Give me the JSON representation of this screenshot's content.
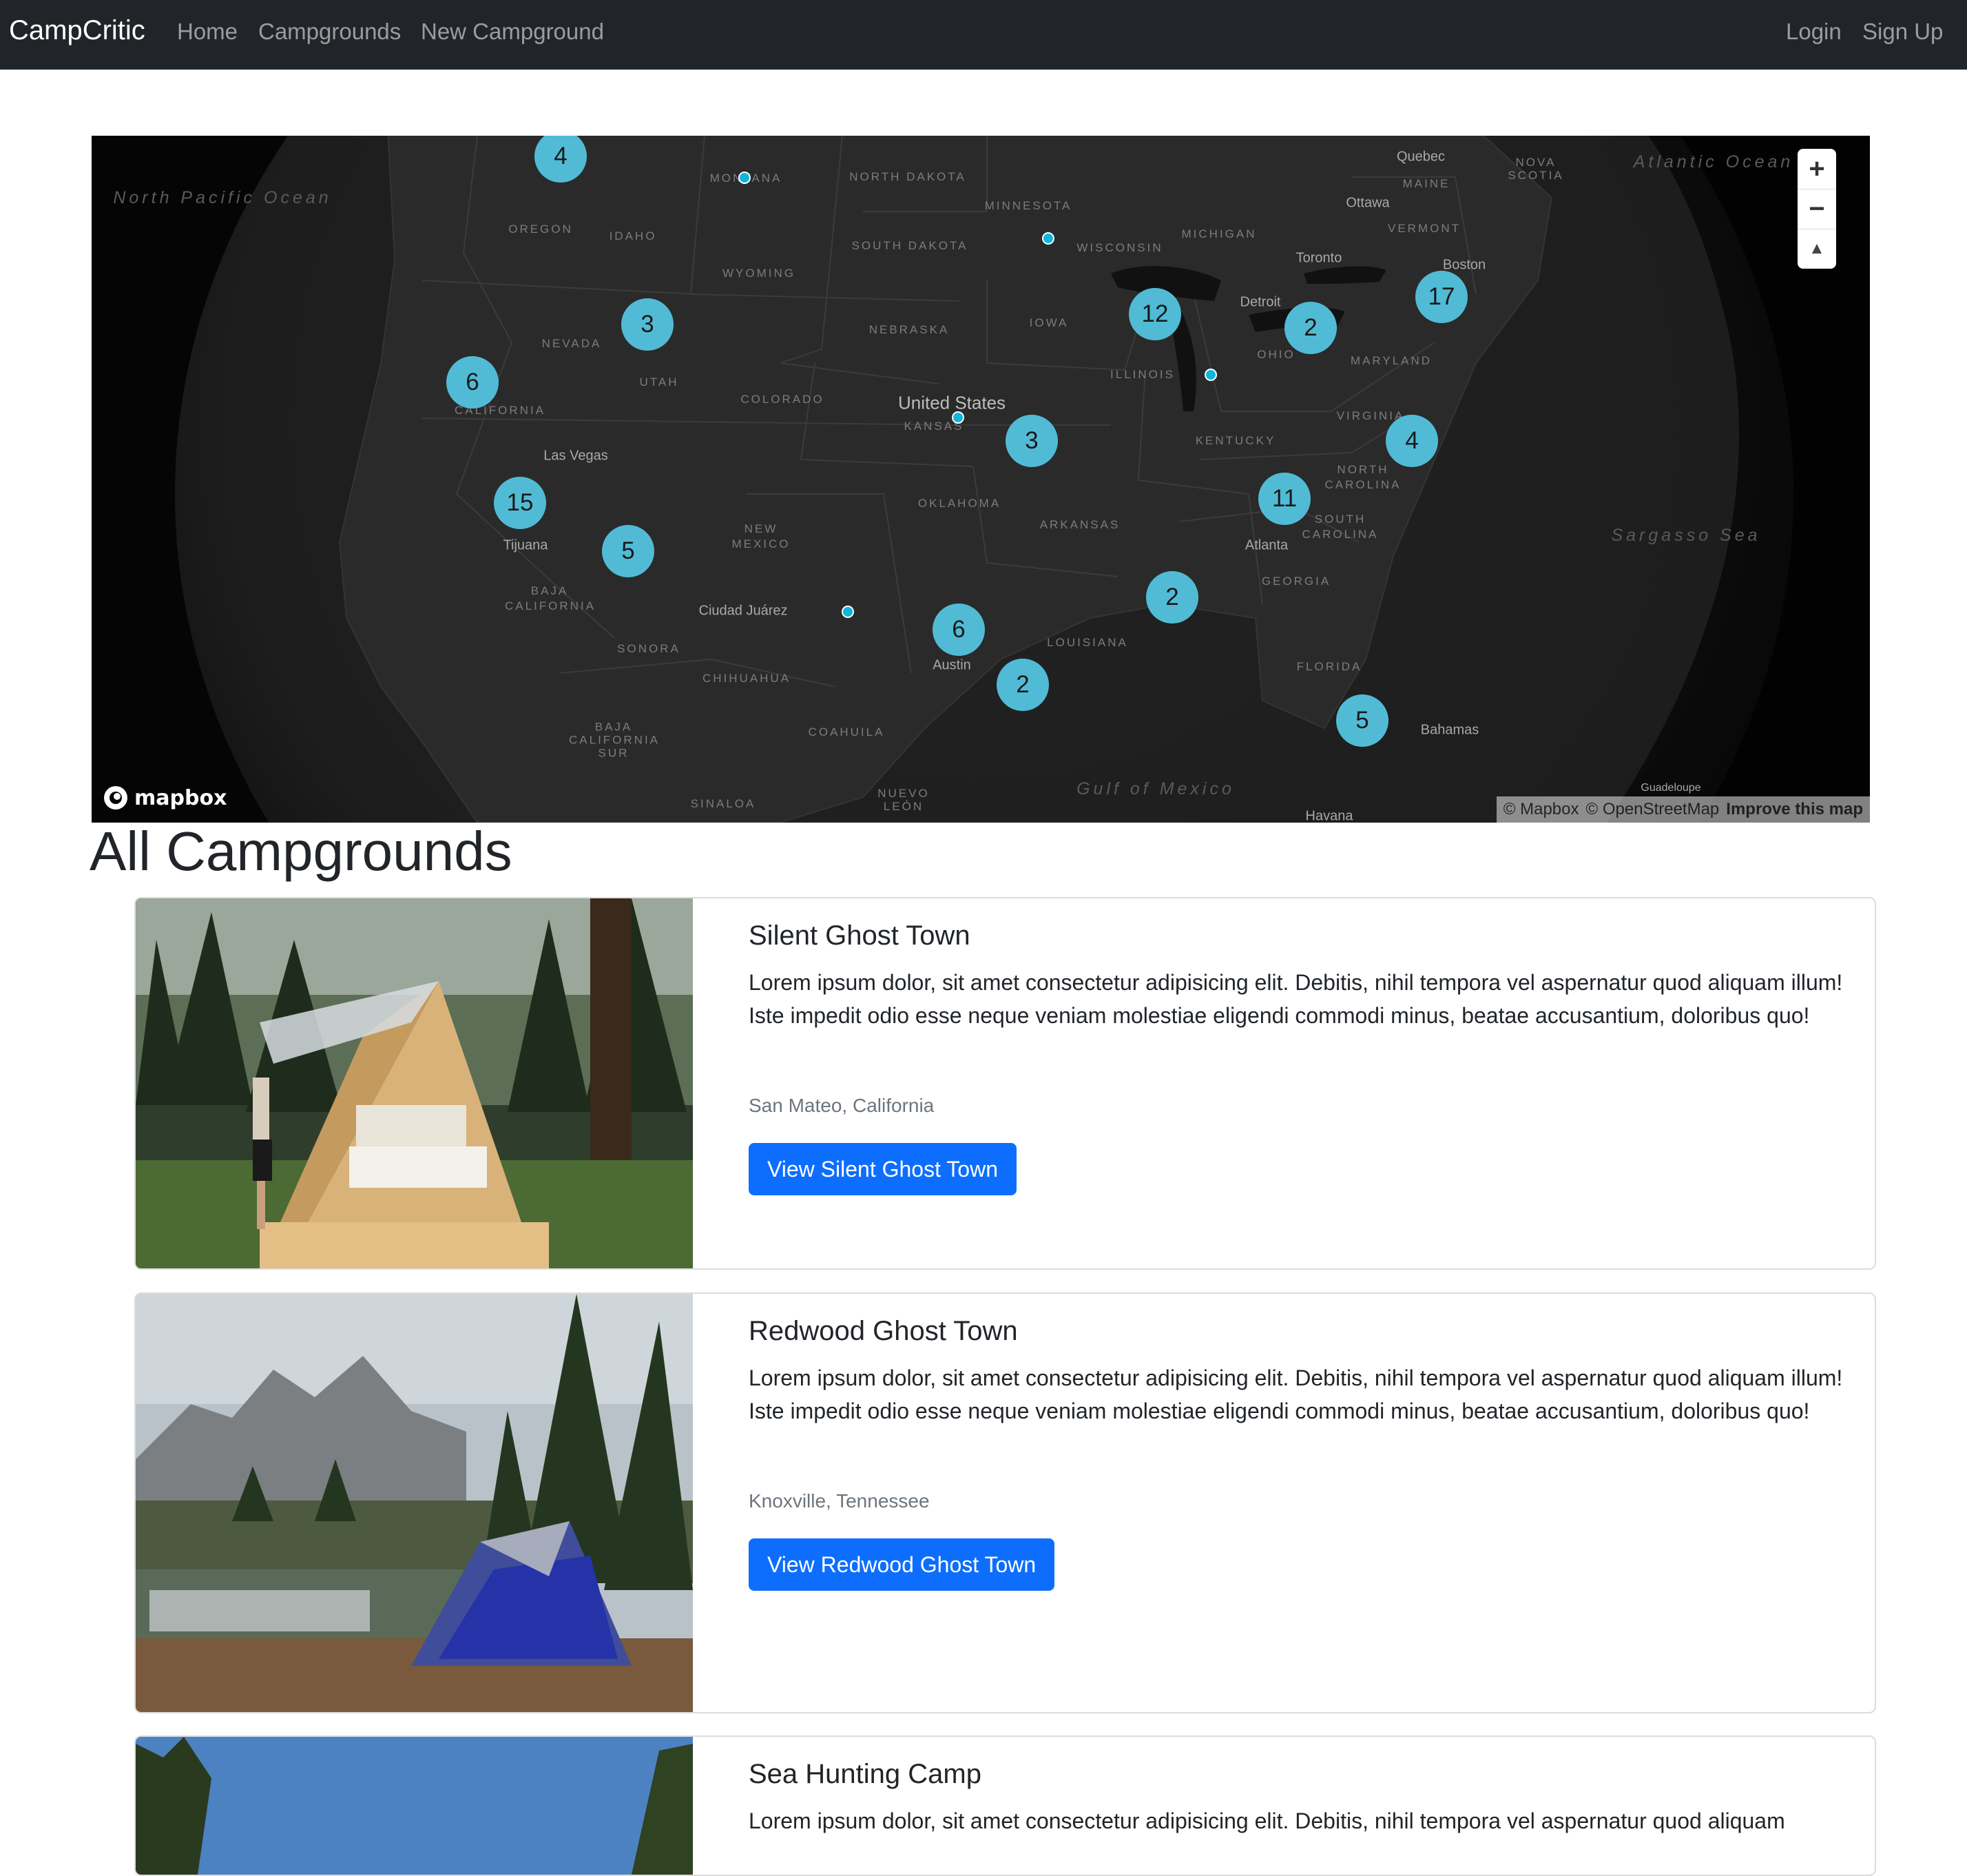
{
  "navbar": {
    "brand": "CampCritic",
    "links": [
      "Home",
      "Campgrounds",
      "New Campground"
    ],
    "auth": [
      "Login",
      "Sign Up"
    ]
  },
  "map": {
    "state_labels": [
      "MONTANA",
      "NORTH DAKOTA",
      "MINNESOTA",
      "OREGON",
      "IDAHO",
      "SOUTH DAKOTA",
      "WISCONSIN",
      "MICHIGAN",
      "WYOMING",
      "NEBRASKA",
      "IOWA",
      "NEVADA",
      "UTAH",
      "COLORADO",
      "ILLINOIS",
      "OHIO",
      "MARYLAND",
      "CALIFORNIA",
      "KANSAS",
      "VIRGINIA",
      "KENTUCKY",
      "NORTH CAROLINA",
      "OKLAHOMA",
      "ARKANSAS",
      "SOUTH CAROLINA",
      "NEW MEXICO",
      "GEORGIA",
      "BAJA CALIFORNIA",
      "SONORA",
      "CHIHUAHUA",
      "LOUISIANA",
      "FLORIDA",
      "COAHUILA",
      "BAJA CALIFORNIA SUR",
      "SINALOA",
      "NUEVO LEÓN",
      "MAINE",
      "VERMONT",
      "NOVA SCOTIA"
    ],
    "city_labels": [
      "Quebec",
      "Ottawa",
      "Toronto",
      "Boston",
      "Detroit",
      "Las Vegas",
      "Tijuana",
      "Atlanta",
      "Ciudad Juárez",
      "Austin",
      "Bahamas",
      "Havana",
      "Guadeloupe"
    ],
    "country_label": "United States",
    "water_labels": [
      "North Pacific Ocean",
      "Atlantic Ocean",
      "Sargasso Sea",
      "Gulf of Mexico"
    ],
    "clusters": [
      "4",
      "3",
      "6",
      "12",
      "2",
      "17",
      "3",
      "4",
      "15",
      "5",
      "11",
      "2",
      "6",
      "2",
      "5"
    ],
    "controls": {
      "zoom_in": "+",
      "zoom_out": "−",
      "compass": "▲"
    },
    "logo": "mapbox",
    "attribution": [
      "© Mapbox",
      "© OpenStreetMap",
      "Improve this map"
    ]
  },
  "page_title": "All Campgrounds",
  "campgrounds": [
    {
      "title": "Silent Ghost Town",
      "description": "Lorem ipsum dolor, sit amet consectetur adipisicing elit. Debitis, nihil tempora vel aspernatur quod aliquam illum! Iste impedit odio esse neque veniam molestiae eligendi commodi minus, beatae accusantium, doloribus quo!",
      "location": "San Mateo, California",
      "button": "View Silent Ghost Town"
    },
    {
      "title": "Redwood Ghost Town",
      "description": "Lorem ipsum dolor, sit amet consectetur adipisicing elit. Debitis, nihil tempora vel aspernatur quod aliquam illum! Iste impedit odio esse neque veniam molestiae eligendi commodi minus, beatae accusantium, doloribus quo!",
      "location": "Knoxville, Tennessee",
      "button": "View Redwood Ghost Town"
    },
    {
      "title": "Sea Hunting Camp",
      "description": "Lorem ipsum dolor, sit amet consectetur adipisicing elit. Debitis, nihil tempora vel aspernatur quod aliquam"
    }
  ],
  "colors": {
    "navbar": "#212529",
    "cluster": "#51bbd6",
    "point": "#11b4da",
    "primary_button": "#0d6efd"
  }
}
